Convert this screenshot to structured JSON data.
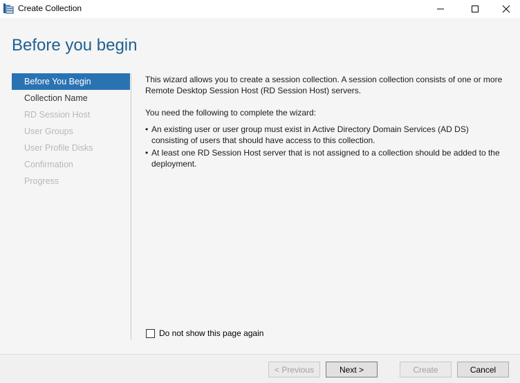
{
  "window": {
    "title": "Create Collection"
  },
  "page": {
    "heading": "Before you begin"
  },
  "nav": {
    "items": [
      {
        "label": "Before You Begin",
        "state": "active"
      },
      {
        "label": "Collection Name",
        "state": "enabled"
      },
      {
        "label": "RD Session Host",
        "state": "disabled"
      },
      {
        "label": "User Groups",
        "state": "disabled"
      },
      {
        "label": "User Profile Disks",
        "state": "disabled"
      },
      {
        "label": "Confirmation",
        "state": "disabled"
      },
      {
        "label": "Progress",
        "state": "disabled"
      }
    ]
  },
  "main": {
    "intro": "This wizard allows you to create a session collection. A session collection consists of one or more Remote Desktop Session Host (RD Session Host) servers.",
    "need_heading": "You need the following to complete the wizard:",
    "bullets": [
      "An existing user or user group must exist in Active Directory Domain Services (AD DS) consisting of users that should have access to this collection.",
      "At least one RD Session Host server that is not assigned to a collection should be added to the deployment."
    ],
    "checkbox_label": "Do not show this page again",
    "checkbox_checked": false
  },
  "footer": {
    "previous_label": "< Previous",
    "next_label": "Next >",
    "create_label": "Create",
    "cancel_label": "Cancel"
  },
  "colors": {
    "heading": "#1e6190",
    "nav_active_bg": "#2a73b3",
    "content_bg": "#f5f5f5"
  }
}
